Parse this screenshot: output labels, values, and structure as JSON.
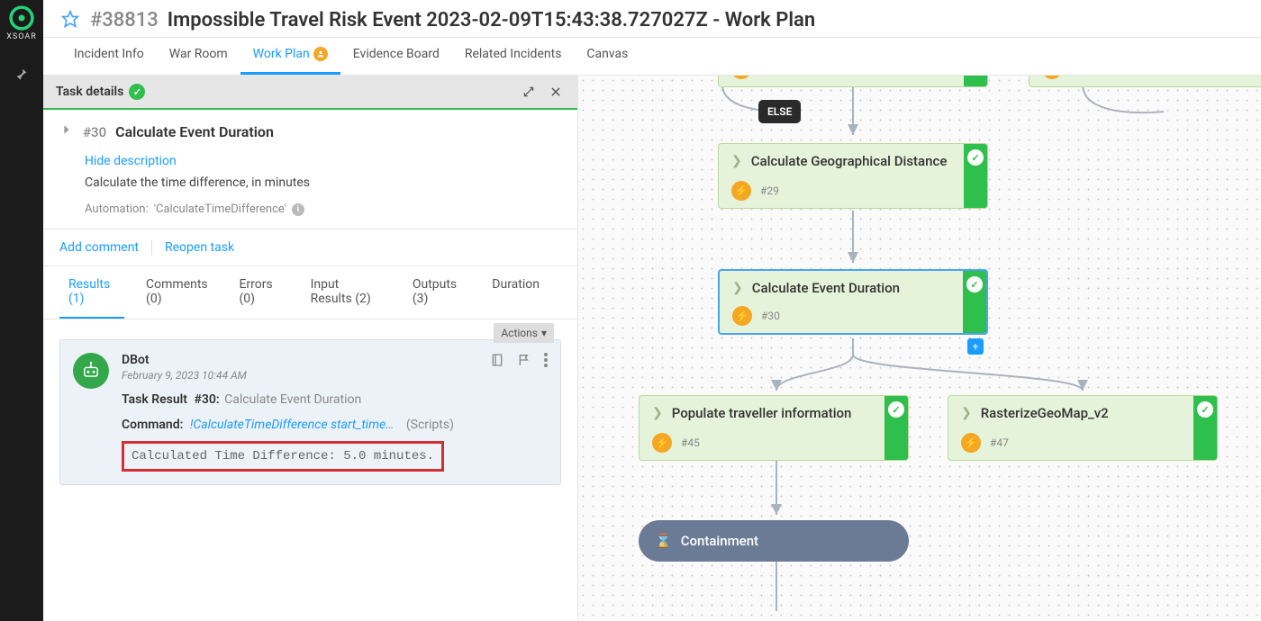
{
  "brand": "XSOAR",
  "header": {
    "incident_id": "#38813",
    "incident_title": "Impossible Travel Risk Event 2023-02-09T15:43:38.727027Z - Work Plan"
  },
  "tabs": [
    {
      "label": "Incident Info"
    },
    {
      "label": "War Room"
    },
    {
      "label": "Work Plan",
      "active": true,
      "badge": true
    },
    {
      "label": "Evidence Board"
    },
    {
      "label": "Related Incidents"
    },
    {
      "label": "Canvas"
    }
  ],
  "panel": {
    "header_title": "Task details",
    "task_number": "#30",
    "task_name": "Calculate Event Duration",
    "hide_description": "Hide description",
    "description": "Calculate the time difference, in minutes",
    "automation_label": "Automation:",
    "automation_name": "'CalculateTimeDifference'",
    "add_comment": "Add comment",
    "reopen_task": "Reopen task"
  },
  "subtabs": [
    {
      "label": "Results (1)",
      "active": true
    },
    {
      "label": "Comments (0)"
    },
    {
      "label": "Errors (0)"
    },
    {
      "label": "Input Results (2)"
    },
    {
      "label": "Outputs (3)"
    },
    {
      "label": "Duration"
    }
  ],
  "actions_dropdown": "Actions",
  "result": {
    "author": "DBot",
    "timestamp": "February 9, 2023 10:44 AM",
    "task_result_label": "Task Result",
    "task_result_num": "#30:",
    "task_result_name": "Calculate Event Duration",
    "command_label": "Command:",
    "command_value": "!CalculateTimeDifference start_time…",
    "command_source": "(Scripts)",
    "output": "Calculated Time Difference: 5.0 minutes."
  },
  "canvas": {
    "else_label": "ELSE",
    "nodes": {
      "n29": {
        "title": "Calculate Geographical Distance",
        "id": "#29"
      },
      "n30": {
        "title": "Calculate Event Duration",
        "id": "#30"
      },
      "n45": {
        "title": "Populate traveller information",
        "id": "#45"
      },
      "n47": {
        "title": "RasterizeGeoMap_v2",
        "id": "#47"
      }
    },
    "section": {
      "title": "Containment"
    }
  }
}
